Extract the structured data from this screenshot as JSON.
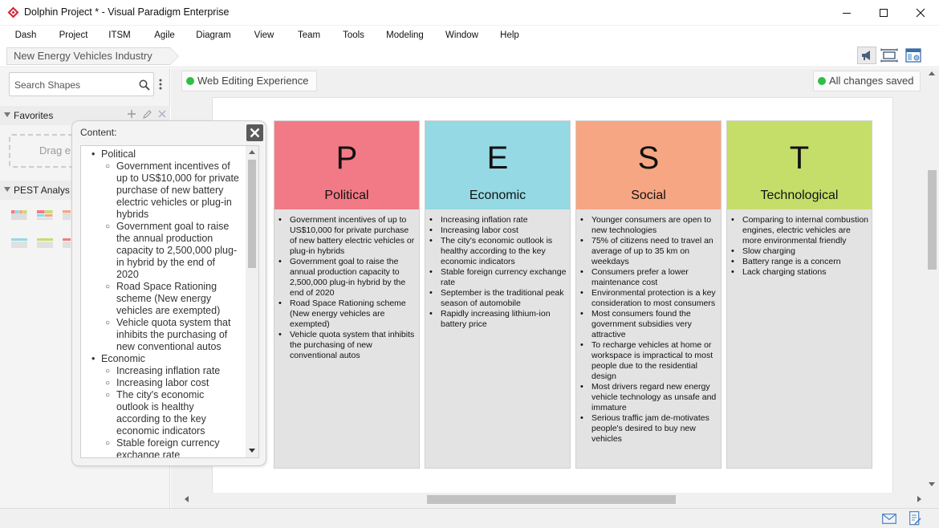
{
  "window": {
    "title": "Dolphin Project * - Visual Paradigm Enterprise"
  },
  "menu": [
    "Dash",
    "Project",
    "ITSM",
    "Agile",
    "Diagram",
    "View",
    "Team",
    "Tools",
    "Modeling",
    "Window",
    "Help"
  ],
  "breadcrumb": "New Energy Vehicles Industry",
  "left_panel": {
    "search_placeholder": "Search Shapes",
    "favorites_label": "Favorites",
    "drag_hint": "Drag e",
    "pest_section_label": "PEST Analys"
  },
  "status": {
    "web_editing": "Web Editing Experience",
    "saved": "All changes saved"
  },
  "popup": {
    "title": "Content:",
    "outline": [
      {
        "label": "Political",
        "items": [
          "Government incentives of up to US$10,000 for private purchase of new battery electric vehicles or plug-in hybrids",
          "Government goal to raise the annual production capacity to 2,500,000 plug-in hybrid by the end of 2020",
          "Road Space Rationing scheme (New energy vehicles are exempted)",
          "Vehicle quota system that inhibits the purchasing of new conventional autos"
        ]
      },
      {
        "label": "Economic",
        "items": [
          "Increasing inflation rate",
          "Increasing labor cost",
          "The city's economic outlook is healthy according to the key economic indicators",
          "Stable foreign currency exchange rate"
        ]
      }
    ]
  },
  "pest": [
    {
      "letter": "P",
      "name": "Political",
      "color": "#f27a86",
      "items": [
        "Government incentives of up to US$10,000 for private purchase of new battery electric vehicles or plug-in hybrids",
        "Government goal to raise the annual production capacity to 2,500,000 plug-in hybrid by the end of 2020",
        "Road Space Rationing scheme (New energy vehicles are exempted)",
        "Vehicle quota system that inhibits the purchasing of new conventional autos"
      ]
    },
    {
      "letter": "E",
      "name": "Economic",
      "color": "#94d9e3",
      "items": [
        "Increasing inflation rate",
        "Increasing labor cost",
        "The city's economic outlook is healthy according to the key economic indicators",
        "Stable foreign currency exchange rate",
        "September is the traditional peak season of automobile",
        "Rapidly increasing lithium-ion battery price"
      ]
    },
    {
      "letter": "S",
      "name": "Social",
      "color": "#f6a683",
      "items": [
        "Younger consumers are open to new technologies",
        "75% of citizens need to travel an average of up to 35 km on weekdays",
        "Consumers prefer a lower maintenance cost",
        "Environmental protection is a key consideration to most consumers",
        "Most consumers found the government subsidies very attractive",
        "To recharge vehicles at home or workspace is impractical to most people due to the residential design",
        "Most drivers regard new energy vehicle technology as unsafe and immature",
        "Serious traffic jam de-motivates people's desired to buy new vehicles"
      ]
    },
    {
      "letter": "T",
      "name": "Technological",
      "color": "#c5de6a",
      "items": [
        "Comparing to internal combustion engines, electric vehicles are more environmental friendly",
        "Slow charging",
        "Battery range is a concern",
        "Lack charging stations"
      ]
    }
  ],
  "icons": {
    "app": "visual-paradigm-logo-icon",
    "minimize": "minimize-icon",
    "maximize": "maximize-icon",
    "close": "close-icon",
    "search": "search-icon",
    "more": "more-vertical-icon",
    "add": "plus-icon",
    "edit": "pencil-icon",
    "remove": "x-icon",
    "announce": "megaphone-icon",
    "fit": "fit-to-window-icon",
    "panel": "panel-toggle-icon",
    "mail": "mail-icon",
    "notes": "notes-icon"
  }
}
